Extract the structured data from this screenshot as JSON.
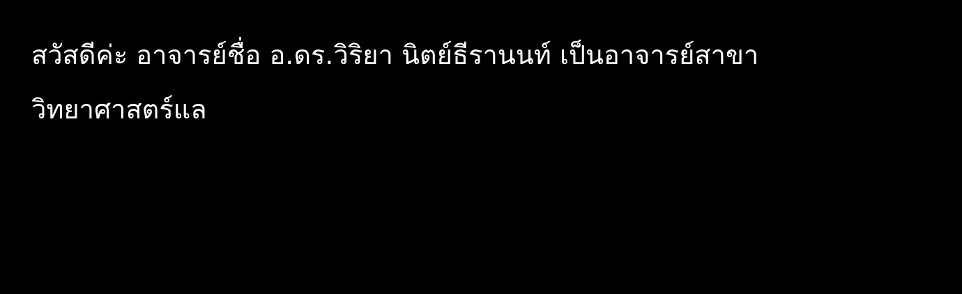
{
  "caption": {
    "lines": [
      "สวัสดีค่ะ อาจารย์ชื่อ อ.ดร.วิริยา นิตย์ธีรานนท์ เป็นอาจารย์สาขา",
      "วิทยาศาสตร์แล"
    ]
  }
}
